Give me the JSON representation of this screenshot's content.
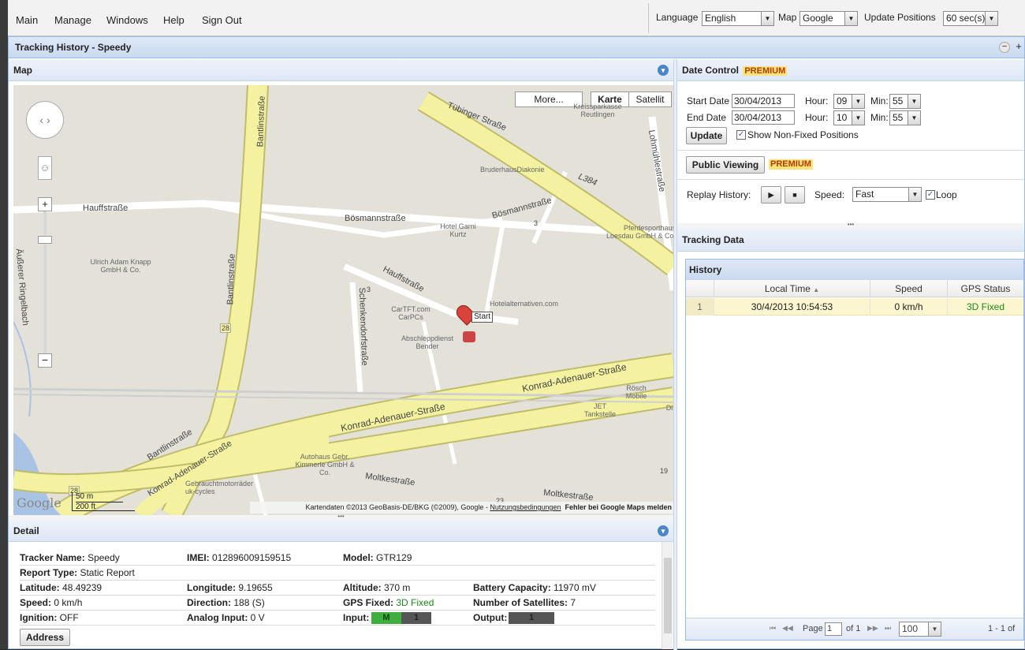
{
  "menu": [
    "Main",
    "Manage",
    "Windows",
    "Help",
    "Sign Out"
  ],
  "top_controls": {
    "language_label": "Language",
    "language_value": "English",
    "map_label": "Map",
    "map_value": "Google",
    "update_label": "Update Positions",
    "update_value": "60 sec(s)"
  },
  "window": {
    "title": "Tracking History - Speedy",
    "min_icon": "minus-icon",
    "max_icon": "plus-icon"
  },
  "map_panel": {
    "title": "Map",
    "more_button": "More...",
    "map_type_karte": "Karte",
    "map_type_satellit": "Satellit",
    "start_label": "Start",
    "google_logo": "Google",
    "scale_metric": "50 m",
    "scale_imperial": "200 ft",
    "attribution": "Kartendaten ©2013 GeoBasis-DE/BKG (©2009), Google - ",
    "terms_link": "Nutzungsbedingungen",
    "report_link": "Fehler bei Google Maps melden",
    "streets": [
      "Tübinger Straße",
      "Bantlinstraße",
      "Hauffstraße",
      "Bösmannstraße",
      "Bösmannstraße",
      "Hauffstraße",
      "Äußerer Ringelbach",
      "Bantlinstraße",
      "Schenkendorfstraße",
      "Lohmühlestraße",
      "L384",
      "Konrad-Adenauer-Straße",
      "Konrad-Adenauer-Straße",
      "Konrad-Adenauer-Straße",
      "Bantlinstraße",
      "Moltkestraße",
      "Moltkestraße",
      "28",
      "28",
      "3",
      "3",
      "19",
      "23"
    ],
    "pois": [
      "Kreissparkasse Reutlingen",
      "BruderhausDiakonie",
      "Hotel Garni Kurtz",
      "Pferdesporthaus Loesdau GmbH & Co.",
      "Ulrich Adam Knapp GmbH & Co.",
      "CarTFT.com CarPCs",
      "Hotelalternativen.com",
      "Abschleppdienst Bender",
      "Rösch Mobile",
      "JET Tankstelle",
      "Autohaus Gebr. Kimmerle GmbH & Co.",
      "Gebrauchtmotorräder uk-cycles",
      "Di"
    ]
  },
  "detail": {
    "title": "Detail",
    "rows": [
      [
        {
          "label": "Tracker Name:",
          "value": "Speedy"
        },
        {
          "label": "IMEI:",
          "value": "012896009159515"
        },
        {
          "label": "Model:",
          "value": "GTR129"
        }
      ],
      [
        {
          "label": "Report Type:",
          "value": "Static Report"
        }
      ],
      [
        {
          "label": "Latitude:",
          "value": "48.49239"
        },
        {
          "label": "Longitude:",
          "value": "9.19655"
        },
        {
          "label": "Altitude:",
          "value": "370 m"
        },
        {
          "label": "Battery Capacity:",
          "value": "11970 mV"
        }
      ],
      [
        {
          "label": "Speed:",
          "value": "0 km/h"
        },
        {
          "label": "Direction:",
          "value": "188 (S)"
        },
        {
          "label": "GPS Fixed:",
          "value": "3D Fixed"
        },
        {
          "label": "Number of Satellites:",
          "value": "7"
        }
      ],
      [
        {
          "label": "Ignition:",
          "value": "OFF"
        },
        {
          "label": "Analog Input:",
          "value": "0 V"
        },
        {
          "label": "Input:",
          "value": ""
        },
        {
          "label": "Output:",
          "value": ""
        }
      ]
    ],
    "input_m": "M",
    "input_1": "1",
    "output_1": "1",
    "address_button": "Address"
  },
  "date_control": {
    "title": "Date Control",
    "premium": "PREMIUM",
    "start_label": "Start Date",
    "start_value": "30/04/2013",
    "end_label": "End Date",
    "end_value": "30/04/2013",
    "hour_label": "Hour:",
    "start_hour": "09",
    "end_hour": "10",
    "min_label": "Min:",
    "start_min": "55",
    "end_min": "55",
    "update_button": "Update",
    "show_nonfixed": "Show Non-Fixed Positions",
    "public_viewing": "Public Viewing",
    "premium2": "PREMIUM",
    "replay_label": "Replay History:",
    "speed_label": "Speed:",
    "speed_value": "Fast",
    "loop_label": "Loop"
  },
  "tracking_data": {
    "title": "Tracking Data",
    "grid_title": "History",
    "columns": [
      "Local Time",
      "Speed",
      "GPS Status"
    ],
    "rows": [
      [
        "1",
        "30/4/2013 10:54:53",
        "0 km/h",
        "3D Fixed"
      ]
    ],
    "pager": {
      "page_label": "Page",
      "page_value": "1",
      "of_label": "of 1",
      "page_size": "100",
      "summary": "1 - 1 of"
    }
  },
  "colors": {
    "accent": "#4a86c8",
    "road": "#f6f3a8",
    "highway": "#e6e495",
    "fixed_green": "#1a8a1a",
    "selected_row": "#fbf6d0"
  }
}
